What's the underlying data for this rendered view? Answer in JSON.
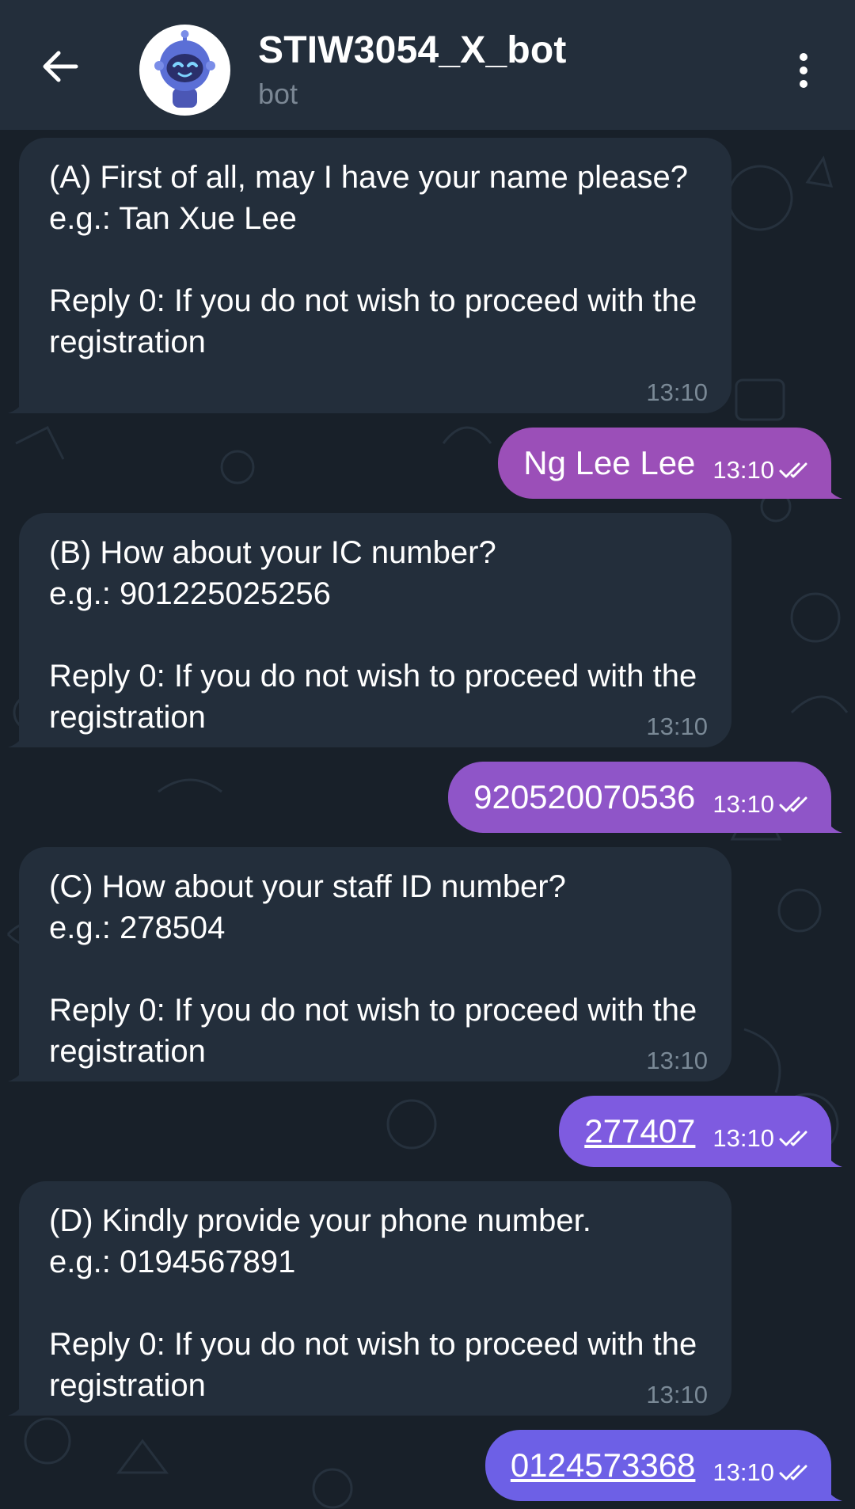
{
  "header": {
    "title": "STIW3054_X_bot",
    "subtitle": "bot"
  },
  "messages": [
    {
      "dir": "in",
      "text": "(A) First of all, may I have your name please?\ne.g.: Tan Xue Lee\n\nReply 0: If you do not wish to proceed with the registration",
      "time": "13:10"
    },
    {
      "dir": "out",
      "text": "Ng Lee Lee",
      "time": "13:10",
      "link": false
    },
    {
      "dir": "in",
      "text": "(B) How about your IC number?\ne.g.: 901225025256\n\nReply 0: If you do not wish to proceed with the registration",
      "time": "13:10"
    },
    {
      "dir": "out",
      "text": "920520070536",
      "time": "13:10",
      "link": false
    },
    {
      "dir": "in",
      "text": "(C) How about your staff ID number?\ne.g.: 278504\n\nReply 0: If you do not wish to proceed with the registration",
      "time": "13:10"
    },
    {
      "dir": "out",
      "text": "277407",
      "time": "13:10",
      "link": true
    },
    {
      "dir": "in",
      "text": "(D) Kindly provide your phone number.\ne.g.: 0194567891\n\nReply 0: If you do not wish to proceed with the registration",
      "time": "13:10"
    },
    {
      "dir": "out",
      "text": "0124573368",
      "time": "13:10",
      "link": true
    }
  ],
  "colors": {
    "background": "#182029",
    "header": "#232e3b",
    "incoming_bubble": "#232e3b",
    "outgoing_bubble_1": "#9b4fb8",
    "outgoing_bubble_2": "#8f55c8",
    "outgoing_bubble_3": "#7e5be0",
    "outgoing_bubble_4": "#6d60e6"
  },
  "icons": {
    "back": "arrow-left-icon",
    "menu": "more-vertical-icon",
    "read": "double-check-icon",
    "avatar": "robot-avatar"
  }
}
